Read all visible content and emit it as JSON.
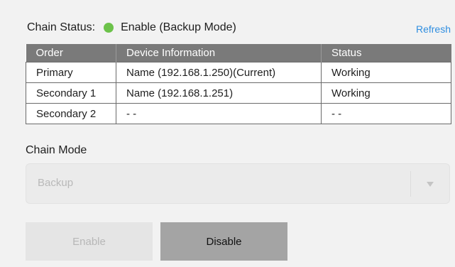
{
  "chain_status": {
    "label": "Chain Status:",
    "value": "Enable (Backup Mode)",
    "indicator_color": "#6cc24a"
  },
  "refresh_label": "Refresh",
  "table": {
    "headers": [
      "Order",
      "Device Information",
      "Status"
    ],
    "rows": [
      [
        "Primary",
        "Name (192.168.1.250)(Current)",
        "Working"
      ],
      [
        "Secondary 1",
        "Name (192.168.1.251)",
        "Working"
      ],
      [
        "Secondary 2",
        "- -",
        "- -"
      ]
    ]
  },
  "chain_mode": {
    "label": "Chain Mode",
    "selected": "Backup"
  },
  "buttons": {
    "enable": "Enable",
    "disable": "Disable"
  }
}
